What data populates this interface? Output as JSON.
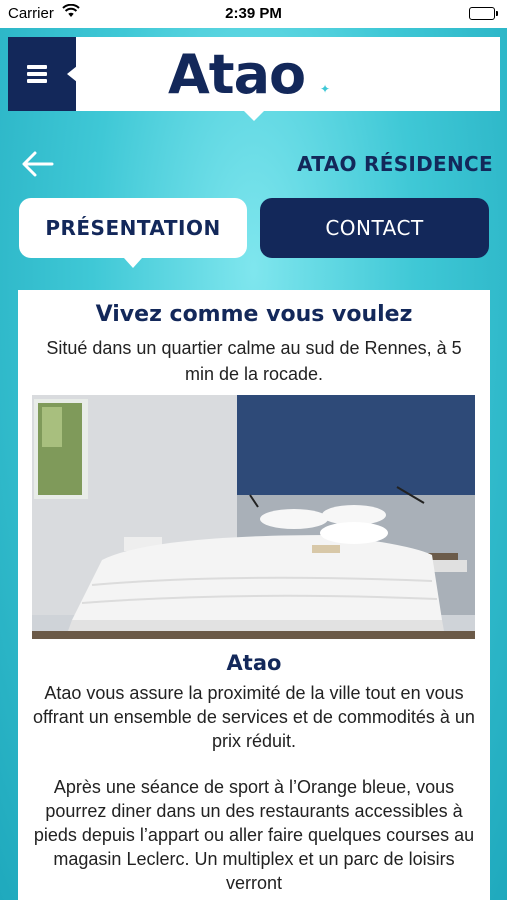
{
  "status_bar": {
    "carrier": "Carrier",
    "time": "2:39 PM"
  },
  "header": {
    "logo": "Atao"
  },
  "nav": {
    "title": "ATAO RÉSIDENCE"
  },
  "tabs": [
    {
      "label": "PRÉSENTATION",
      "active": true
    },
    {
      "label": "CONTACT",
      "active": false
    }
  ],
  "content": {
    "heading": "Vivez comme vous voulez",
    "subtitle": "Situé dans un quartier calme au sud de Rennes, à 5 min de la rocade.",
    "section_title": "Atao",
    "paragraph1": "Atao vous assure la proximité de la ville tout en vous offrant un ensemble de services et de commodités à un prix réduit.",
    "paragraph2": "Après une séance de sport à l’Orange bleue, vous pourrez diner dans un des restaurants accessibles à pieds depuis l’appart ou aller faire quelques courses au magasin Leclerc. Un multiplex et un parc de loisirs verront"
  },
  "colors": {
    "navy": "#13285a",
    "accent": "#3fc8d6"
  }
}
